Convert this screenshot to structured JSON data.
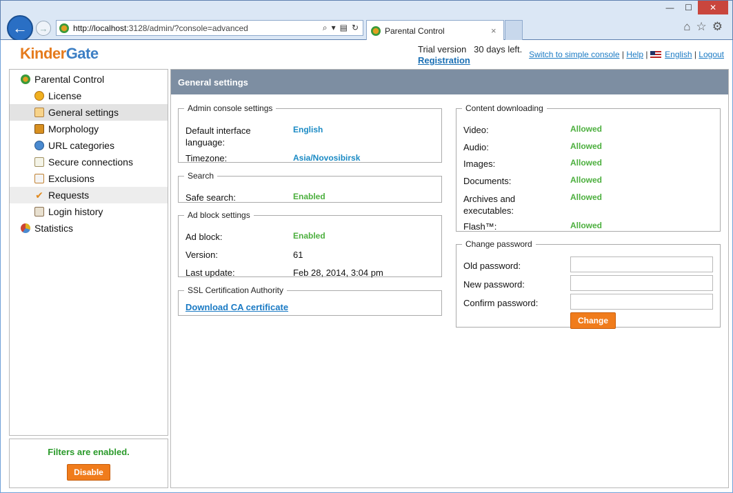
{
  "browser": {
    "url_host": "http://localhost",
    "url_rest": ":3128/admin/?console=advanced",
    "tab_title": "Parental Control",
    "tab_close": "×",
    "win_min": "—",
    "win_max": "☐",
    "win_close": "✕"
  },
  "header": {
    "logo_kinder": "Kinder",
    "logo_gate": "Gate",
    "trial_label": "Trial version",
    "trial_days": "30 days left.",
    "registration": "Registration",
    "switch_console": "Switch to simple console",
    "help": "Help",
    "language": "English",
    "logout": "Logout"
  },
  "sidebar": {
    "root": "Parental Control",
    "items": [
      {
        "label": "License",
        "icon": "license-icon"
      },
      {
        "label": "General settings",
        "icon": "general-settings-icon"
      },
      {
        "label": "Morphology",
        "icon": "morphology-icon"
      },
      {
        "label": "URL categories",
        "icon": "url-categories-icon"
      },
      {
        "label": "Secure connections",
        "icon": "secure-connections-icon"
      },
      {
        "label": "Exclusions",
        "icon": "exclusions-icon"
      },
      {
        "label": "Requests",
        "icon": "requests-icon"
      },
      {
        "label": "Login history",
        "icon": "login-history-icon"
      }
    ],
    "statistics": "Statistics",
    "filters_status": "Filters are enabled.",
    "disable_button": "Disable"
  },
  "main": {
    "title": "General settings",
    "admin_console": {
      "legend": "Admin console settings",
      "lang_label_1": "Default interface",
      "lang_label_2": "language:",
      "lang_value": "English",
      "timezone_label": "Timezone:",
      "timezone_value": "Asia/Novosibirsk"
    },
    "search": {
      "legend": "Search",
      "safe_label": "Safe search:",
      "safe_value": "Enabled"
    },
    "adblock": {
      "legend": "Ad block settings",
      "adblock_label": "Ad block:",
      "adblock_value": "Enabled",
      "version_label": "Version:",
      "version_value": "61",
      "update_label": "Last update:",
      "update_value": "Feb 28, 2014, 3:04 pm"
    },
    "ssl": {
      "legend": "SSL Certification Authority",
      "download_link": "Download CA certificate"
    },
    "content": {
      "legend": "Content downloading",
      "video_label": "Video:",
      "video_value": "Allowed",
      "audio_label": "Audio:",
      "audio_value": "Allowed",
      "images_label": "Images:",
      "images_value": "Allowed",
      "documents_label": "Documents:",
      "documents_value": "Allowed",
      "archives_label_1": "Archives and",
      "archives_label_2": "executables:",
      "archives_value": "Allowed",
      "flash_label": "Flash™:",
      "flash_value": "Allowed"
    },
    "password": {
      "legend": "Change password",
      "old_label": "Old password:",
      "new_label": "New password:",
      "confirm_label": "Confirm password:",
      "change_button": "Change"
    }
  },
  "colors": {
    "accent_orange": "#f07c1c",
    "status_green": "#4caf3e",
    "link_blue": "#1a7ac4",
    "header_bar": "#7d8ea2"
  }
}
